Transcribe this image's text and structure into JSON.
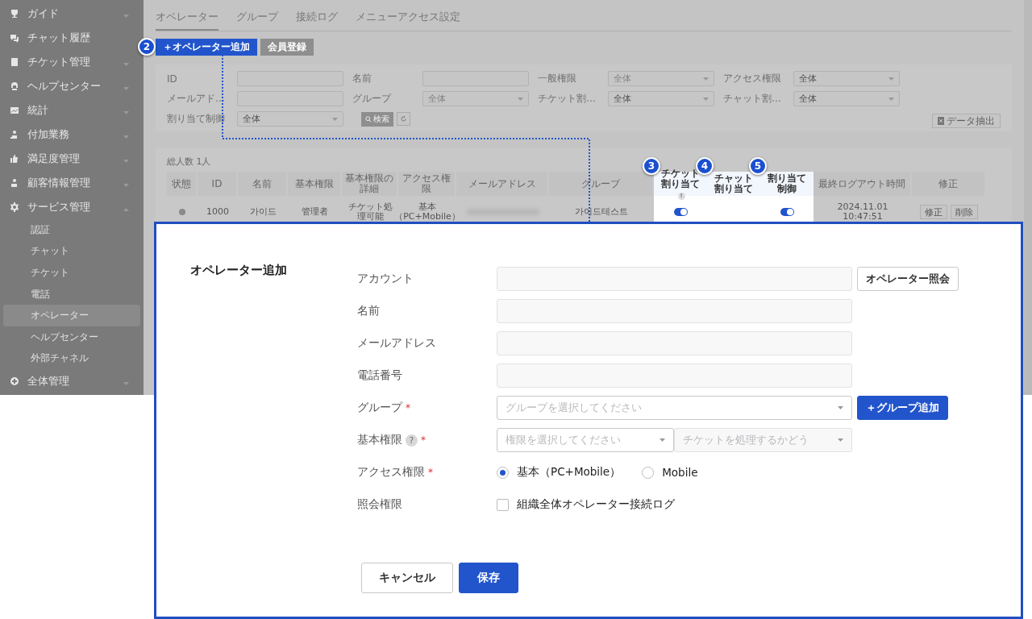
{
  "sidebar": {
    "items": [
      {
        "label": "ガイド",
        "kind": "group",
        "expanded": false
      },
      {
        "label": "チャット履歴",
        "kind": "link"
      },
      {
        "label": "チケット管理",
        "kind": "group",
        "expanded": false
      },
      {
        "label": "ヘルプセンター",
        "kind": "group",
        "expanded": false
      },
      {
        "label": "統計",
        "kind": "group",
        "expanded": false
      },
      {
        "label": "付加業務",
        "kind": "group",
        "expanded": false
      },
      {
        "label": "満足度管理",
        "kind": "group",
        "expanded": false
      },
      {
        "label": "顧客情報管理",
        "kind": "group",
        "expanded": false
      },
      {
        "label": "サービス管理",
        "kind": "group",
        "expanded": true,
        "children": [
          {
            "label": "認証",
            "selected": false
          },
          {
            "label": "チャット",
            "selected": false
          },
          {
            "label": "チケット",
            "selected": false
          },
          {
            "label": "電話",
            "selected": false
          },
          {
            "label": "オペレーター",
            "selected": true
          },
          {
            "label": "ヘルプセンター",
            "selected": false
          },
          {
            "label": "外部チャネル",
            "selected": false
          }
        ]
      },
      {
        "label": "全体管理",
        "kind": "group",
        "expanded": false
      }
    ]
  },
  "tabs": [
    {
      "label": "オペレーター",
      "selected": true
    },
    {
      "label": "グループ",
      "selected": false
    },
    {
      "label": "接続ログ",
      "selected": false
    },
    {
      "label": "メニューアクセス設定",
      "selected": false
    }
  ],
  "action_buttons": [
    {
      "label": "＋オペレーター追加",
      "kind": "primary",
      "badge": "2"
    },
    {
      "label": "会員登録",
      "kind": "secondary"
    }
  ],
  "filters": [
    {
      "label": "ID",
      "kind": "input"
    },
    {
      "label": "名前",
      "kind": "input"
    },
    {
      "label": "一般権限",
      "kind": "select",
      "placeholder": "全体"
    },
    {
      "label": "アクセス権限",
      "kind": "select",
      "value": "全体"
    },
    {
      "label": "メールアド…",
      "kind": "input"
    },
    {
      "label": "グループ",
      "kind": "select",
      "placeholder": "全体"
    },
    {
      "label": "チケット割…",
      "kind": "select",
      "value": "全体"
    },
    {
      "label": "チャット割…",
      "kind": "select",
      "value": "全体"
    },
    {
      "label": "割り当て制御",
      "kind": "select",
      "value": "全体"
    }
  ],
  "search_button": "検索",
  "export_button": "データ抽出",
  "table": {
    "total": "総人数 1人",
    "columns": [
      {
        "label": "状態",
        "highlighted": false
      },
      {
        "label": "ID",
        "highlighted": false
      },
      {
        "label": "名前",
        "highlighted": false
      },
      {
        "label": "基本権限",
        "highlighted": false
      },
      {
        "label": "基本権限の詳細",
        "highlighted": false
      },
      {
        "label": "アクセス権限",
        "highlighted": false
      },
      {
        "label": "メールアドレス",
        "highlighted": false
      },
      {
        "label": "グループ",
        "highlighted": false
      },
      {
        "label": "チケット割り当て",
        "highlighted": true,
        "badge": "3",
        "info": "!"
      },
      {
        "label": "チャット割り当て",
        "highlighted": true,
        "badge": "4"
      },
      {
        "label": "割り当て制御",
        "highlighted": true,
        "badge": "5"
      },
      {
        "label": "最終ログアウト時間",
        "highlighted": false
      },
      {
        "label": "修正",
        "highlighted": false
      }
    ],
    "rows": [
      {
        "cells": [
          {
            "kind": "dot"
          },
          {
            "kind": "text",
            "text": "1000"
          },
          {
            "kind": "text",
            "text": "가이드"
          },
          {
            "kind": "text",
            "text": "管理者"
          },
          {
            "kind": "text",
            "text": "チケット処理可能"
          },
          {
            "kind": "text",
            "text": "基本（PC+Mobile）"
          },
          {
            "kind": "blurred"
          },
          {
            "kind": "text",
            "text": "가이드테스트"
          },
          {
            "kind": "toggle",
            "on": true
          },
          {
            "kind": "empty"
          },
          {
            "kind": "toggle",
            "on": true
          },
          {
            "kind": "text",
            "text": "2024.11.01 10:47:51"
          },
          {
            "kind": "buttons",
            "buttons": [
              "修正",
              "削除"
            ]
          }
        ]
      }
    ]
  },
  "dialog": {
    "title": "オペレーター追加",
    "fields": [
      {
        "label": "アカウント",
        "kind": "input",
        "button": {
          "label": "オペレーター照会",
          "kind": "outline"
        }
      },
      {
        "label": "名前",
        "kind": "input"
      },
      {
        "label": "メールアドレス",
        "kind": "input"
      },
      {
        "label": "電話番号",
        "kind": "input"
      },
      {
        "label": "グループ",
        "kind": "select",
        "required_mark": "*",
        "placeholder": "グループを選択してください",
        "button": {
          "label": "＋グループ追加",
          "kind": "primary"
        }
      },
      {
        "label": "基本権限",
        "kind": "select_pair",
        "required_mark": "*",
        "help": "?",
        "selects": [
          {
            "placeholder": "権限を選択してください",
            "disabled": false
          },
          {
            "placeholder": "チケットを処理するかどう",
            "disabled": true
          }
        ]
      },
      {
        "label": "アクセス権限",
        "kind": "radio",
        "required_mark": "*",
        "options": [
          {
            "label": "基本（PC+Mobile）",
            "selected": true
          },
          {
            "label": "Mobile",
            "selected": false
          }
        ]
      },
      {
        "label": "照会権限",
        "kind": "checkbox",
        "options": [
          {
            "label": "組織全体オペレーター接続ログ",
            "checked": false
          }
        ]
      }
    ],
    "buttons": [
      {
        "label": "キャンセル",
        "kind": "outline"
      },
      {
        "label": "保存",
        "kind": "primary"
      }
    ]
  }
}
